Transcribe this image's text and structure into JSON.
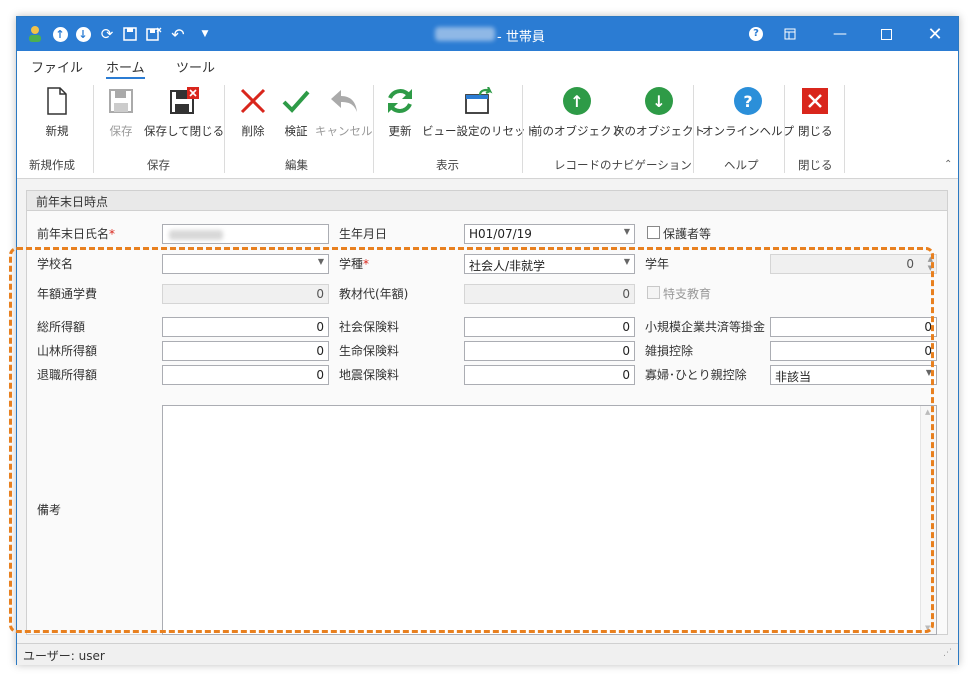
{
  "window": {
    "title": "- 世帯員"
  },
  "ribbon": {
    "tabs": [
      "ファイル",
      "ホーム",
      "ツール"
    ],
    "buttons": {
      "new": "新規",
      "save": "保存",
      "save_close": "保存して閉じる",
      "delete": "削除",
      "validate": "検証",
      "cancel": "キャンセル",
      "refresh": "更新",
      "reset_view": "ビュー設定のリセット",
      "prev_object": "前のオブジェクト",
      "next_object": "次のオブジェクト",
      "online_help": "オンラインヘルプ",
      "close": "閉じる"
    },
    "groups": [
      "新規作成",
      "保存",
      "編集",
      "表示",
      "レコードのナビゲーション",
      "ヘルプ",
      "閉じる"
    ]
  },
  "form": {
    "section_title": "前年末日時点",
    "labels": {
      "prev_name": "前年末日氏名",
      "birthdate": "生年月日",
      "guardian": "保護者等",
      "school_name": "学校名",
      "school_type": "学種",
      "grade": "学年",
      "annual_fee": "年額通学費",
      "material_fee": "教材代(年額)",
      "special_ed": "特支教育",
      "total_income": "総所得額",
      "social_ins": "社会保険料",
      "small_biz": "小規模企業共済等掛金",
      "forest_income": "山林所得額",
      "life_ins": "生命保険料",
      "casualty": "雑損控除",
      "retire_income": "退職所得額",
      "quake_ins": "地震保険料",
      "widow": "寡婦･ひとり親控除",
      "remarks": "備考"
    },
    "required_mark": "*",
    "values": {
      "birthdate": "H01/07/19",
      "school_name": "",
      "school_type": "社会人/非就学",
      "grade": "0",
      "annual_fee": "0",
      "material_fee": "0",
      "total_income": "0",
      "social_ins": "0",
      "small_biz": "0",
      "forest_income": "0",
      "life_ins": "0",
      "casualty": "0",
      "retire_income": "0",
      "quake_ins": "0",
      "widow": "非該当"
    }
  },
  "statusbar": {
    "user": "ユーザー: user"
  },
  "colors": {
    "accent": "#2b7cd3",
    "highlight": "#e8801f",
    "delete": "#d9261c",
    "nav": "#2e9b47",
    "help": "#2b8fd9"
  }
}
